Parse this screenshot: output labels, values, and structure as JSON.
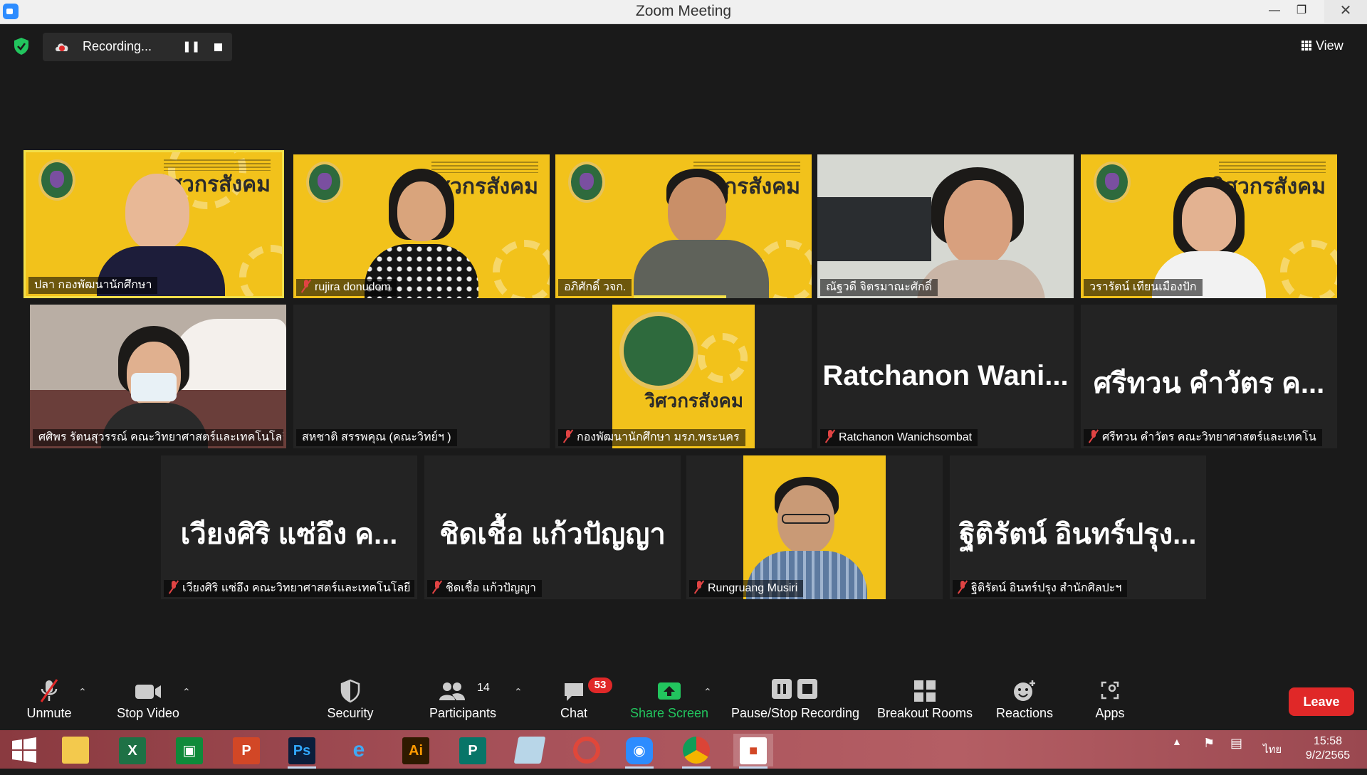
{
  "window": {
    "title": "Zoom Meeting"
  },
  "recording": {
    "status": "Recording..."
  },
  "view": {
    "label": "View"
  },
  "gallery": {
    "row1": [
      {
        "name": "ปลา กองพัฒนานักศึกษา",
        "muted": false
      },
      {
        "name": "rujira donudom",
        "muted": true
      },
      {
        "name": "อภิศักดิ์ วจก.",
        "muted": false
      },
      {
        "name": "ณัฐวดี จิตรมาณะศักดิ์",
        "muted": false
      },
      {
        "name": "วรารัตน์ เทียนเมืองปัก",
        "muted": false
      }
    ],
    "row2": [
      {
        "name": "ศศิพร รัตนสุวรรณ์ คณะวิทยาศาสตร์และเทคโนโลยี",
        "muted": false
      },
      {
        "name": "สหชาติ สรรพคุณ (คณะวิทย์ฯ )",
        "muted": false
      },
      {
        "name": "กองพัฒนานักศึกษา มรภ.พระนคร",
        "muted": true
      },
      {
        "name": "Ratchanon Wanichsombat",
        "display": "Ratchanon  Wani...",
        "muted": true
      },
      {
        "name": "ศรีทวน  คำวัตร คณะวิทยาศาสตร์และเทคโน",
        "display": "ศรีทวน  คำวัตร ค...",
        "muted": true
      }
    ],
    "row3": [
      {
        "name": "เวียงศิริ  แซ่อึง  คณะวิทยาศาสตร์และเทคโนโลยี",
        "display": "เวียงศิริ  แซ่อึง  ค...",
        "muted": true
      },
      {
        "name": "ชิดเชื้อ แก้วปัญญา",
        "display": "ชิดเชื้อ แก้วปัญญา",
        "muted": true
      },
      {
        "name": "Rungruang Musiri",
        "muted": true
      },
      {
        "name": "ฐิติรัตน์ อินทร์ปรุง สำนักศิลปะฯ",
        "display": "ฐิติรัตน์ อินทร์ปรุง...",
        "muted": true
      }
    ],
    "banner_text": "วิศวกรสังคม"
  },
  "toolbar": {
    "unmute": "Unmute",
    "stop_video": "Stop Video",
    "security": "Security",
    "participants": "Participants",
    "participants_count": "14",
    "chat": "Chat",
    "chat_badge": "53",
    "share_screen": "Share Screen",
    "pause_stop_recording": "Pause/Stop Recording",
    "breakout_rooms": "Breakout Rooms",
    "reactions": "Reactions",
    "apps": "Apps",
    "leave": "Leave"
  },
  "taskbar": {
    "language": "ไทย",
    "time": "15:58",
    "date": "9/2/2565"
  },
  "colors": {
    "accent_green": "#22c55e",
    "leave_red": "#e02828",
    "active_speaker": "#f4e04a",
    "banner_yellow": "#f2c21b"
  }
}
